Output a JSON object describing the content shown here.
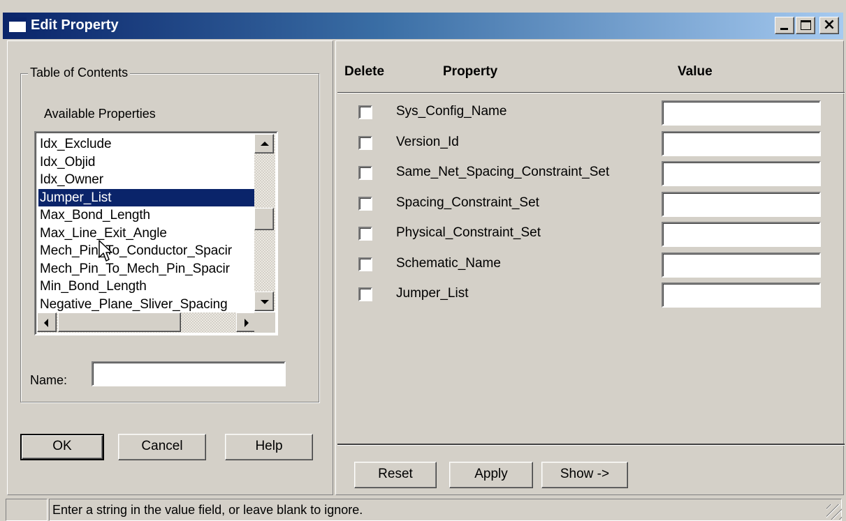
{
  "window": {
    "title": "Edit Property",
    "controls": {
      "minimize": "minimize-icon",
      "maximize": "maximize-icon",
      "close": "close-icon"
    }
  },
  "toc": {
    "group_label": "Table of Contents",
    "available_label": "Available Properties",
    "items": [
      "Idx_Exclude",
      "Idx_Objid",
      "Idx_Owner",
      "Jumper_List",
      "Max_Bond_Length",
      "Max_Line_Exit_Angle",
      "Mech_Pin_To_Conductor_Spacir",
      "Mech_Pin_To_Mech_Pin_Spacir",
      "Min_Bond_Length",
      "Negative_Plane_Sliver_Spacing"
    ],
    "selected_index": 3,
    "name_label": "Name:",
    "name_value": ""
  },
  "left_buttons": {
    "ok": "OK",
    "cancel": "Cancel",
    "help": "Help"
  },
  "properties": {
    "headers": {
      "delete": "Delete",
      "property": "Property",
      "value": "Value"
    },
    "rows": [
      {
        "name": "Sys_Config_Name",
        "value": "",
        "checked": false
      },
      {
        "name": "Version_Id",
        "value": "",
        "checked": false
      },
      {
        "name": "Same_Net_Spacing_Constraint_Set",
        "value": "",
        "checked": false
      },
      {
        "name": "Spacing_Constraint_Set",
        "value": "",
        "checked": false
      },
      {
        "name": "Physical_Constraint_Set",
        "value": "",
        "checked": false
      },
      {
        "name": "Schematic_Name",
        "value": "",
        "checked": false
      },
      {
        "name": "Jumper_List",
        "value": "",
        "checked": false
      }
    ]
  },
  "right_buttons": {
    "reset": "Reset",
    "apply": "Apply",
    "show": "Show ->"
  },
  "status": {
    "message": "Enter a string in the value field, or leave blank to ignore."
  }
}
